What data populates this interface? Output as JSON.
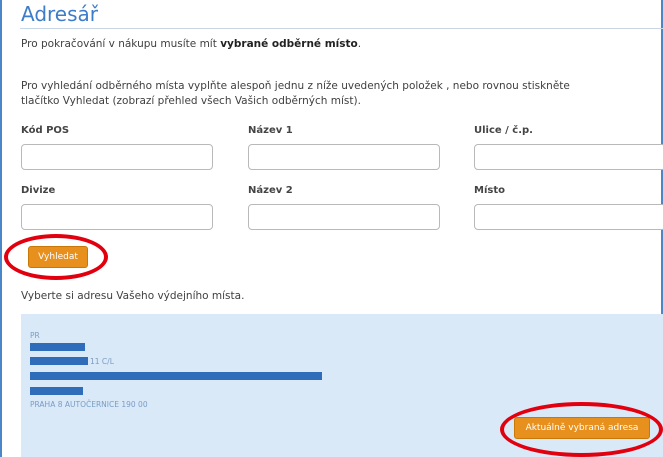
{
  "page": {
    "title": "Adresář",
    "intro_text": "Pro pokračování v nákupu musíte mít",
    "intro_bold": "vybrané odběrné místo",
    "intro_end": ".",
    "help_line1": "Pro vyhledání odběrného místa vyplňte alespoň jednu z níže uvedených položek , nebo rovnou stiskněte",
    "help_line2": "tlačítko Vyhledat (zobrazí přehled všech Vašich odběrných míst)."
  },
  "form": {
    "fields": [
      {
        "label": "Kód POS",
        "value": ""
      },
      {
        "label": "Název 1",
        "value": ""
      },
      {
        "label": "Ulice / č.p.",
        "value": ""
      },
      {
        "label": "Divize",
        "value": ""
      },
      {
        "label": "Název 2",
        "value": ""
      },
      {
        "label": "Místo",
        "value": ""
      }
    ],
    "search_button": "Vyhledat"
  },
  "results": {
    "prompt": "Vyberte si adresu Vašeho výdejního místa.",
    "address": {
      "line1": "PR",
      "line3_suffix": "11 C/L",
      "line6": "PRAHA 8 AUTOČERNICE 190 00"
    },
    "select_button": "Aktuálně vybraná adresa"
  },
  "colors": {
    "accent_button": "#e8901e",
    "title_blue": "#3d7cc9",
    "panel_bg": "#d9e9f8",
    "redaction": "#2f6dbb",
    "highlight_ring": "#e2000f"
  }
}
